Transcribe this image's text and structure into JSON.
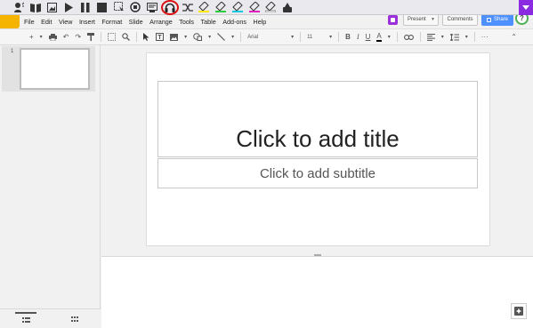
{
  "extension_toolbar": {
    "icons": [
      "speak-icon",
      "dictionary-icon",
      "picture-dictionary-icon",
      "play-icon",
      "pause-icon",
      "stop-icon",
      "screenshot-reader-icon",
      "audio-maker-icon",
      "web-search-icon",
      "listen-headphones-icon",
      "vocabulary-icon",
      "highlighter-yellow-icon",
      "highlighter-green-icon",
      "highlighter-cyan-icon",
      "highlighter-magenta-icon",
      "highlighter-clear-icon",
      "collect-highlights-icon"
    ],
    "active_icon": "listen-headphones-icon",
    "highlight_colors": {
      "yellow": "#ffe600",
      "green": "#2ecc40",
      "cyan": "#10c8e0",
      "magenta": "#e020c0",
      "accent": "#8a2be2"
    }
  },
  "menubar": {
    "items": [
      "File",
      "Edit",
      "View",
      "Insert",
      "Format",
      "Slide",
      "Arrange",
      "Tools",
      "Table",
      "Add-ons",
      "Help"
    ]
  },
  "header": {
    "present_label": "Present",
    "comments_label": "Comments",
    "share_label": "Share",
    "share_color": "#4d90fe",
    "help_label": "?"
  },
  "toolbar": {
    "font_name": "Arial",
    "font_size": "11",
    "bold": "B",
    "italic": "I",
    "underline": "U",
    "text_color": "A",
    "more": "···"
  },
  "filmstrip": {
    "slide_number": "1"
  },
  "slide": {
    "title_placeholder": "Click to add title",
    "subtitle_placeholder": "Click to add subtitle"
  }
}
